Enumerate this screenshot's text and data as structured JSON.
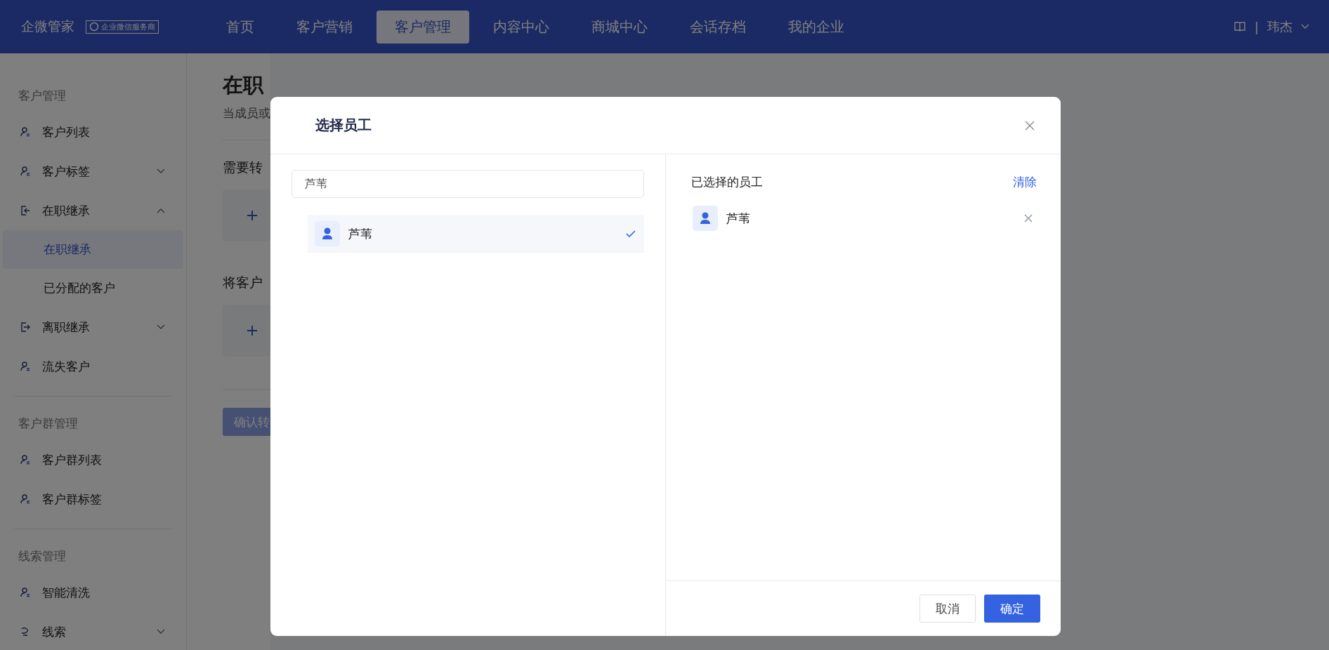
{
  "topbar": {
    "logo": "企微管家",
    "badge": "企业微信服务商",
    "nav": [
      {
        "label": "首页",
        "selected": false
      },
      {
        "label": "客户营销",
        "selected": false
      },
      {
        "label": "客户管理",
        "selected": true
      },
      {
        "label": "内容中心",
        "selected": false
      },
      {
        "label": "商城中心",
        "selected": false
      },
      {
        "label": "会话存档",
        "selected": false
      },
      {
        "label": "我的企业",
        "selected": false
      }
    ],
    "separator": "|",
    "user": "玮杰"
  },
  "sidebar": [
    {
      "title": "客户管理",
      "items": [
        {
          "label": "客户列表"
        },
        {
          "label": "客户标签",
          "expanded": false
        },
        {
          "label": "在职继承",
          "expanded": true,
          "children": [
            {
              "label": "在职继承",
              "selected": true
            },
            {
              "label": "已分配的客户",
              "selected": false
            }
          ]
        },
        {
          "label": "离职继承",
          "expanded": false
        },
        {
          "label": "流失客户"
        }
      ]
    },
    {
      "title": "客户群管理",
      "items": [
        {
          "label": "客户群列表"
        },
        {
          "label": "客户群标签"
        }
      ]
    },
    {
      "title": "线索管理",
      "items": [
        {
          "label": "智能清洗"
        },
        {
          "label": "线索",
          "expanded": false
        }
      ]
    }
  ],
  "page": {
    "title": "在职",
    "desc": "当成员或",
    "section_1": "需要转",
    "section_2": "将客户",
    "confirm": "确认转"
  },
  "dialog": {
    "title": "选择员工",
    "search": {
      "value": "芦苇"
    },
    "results": [
      {
        "name": "芦苇",
        "selected": true
      }
    ],
    "selected_label": "已选择的员工",
    "clear": "清除",
    "selected": [
      {
        "name": "芦苇"
      }
    ],
    "cancel": "取消",
    "ok": "确定"
  }
}
